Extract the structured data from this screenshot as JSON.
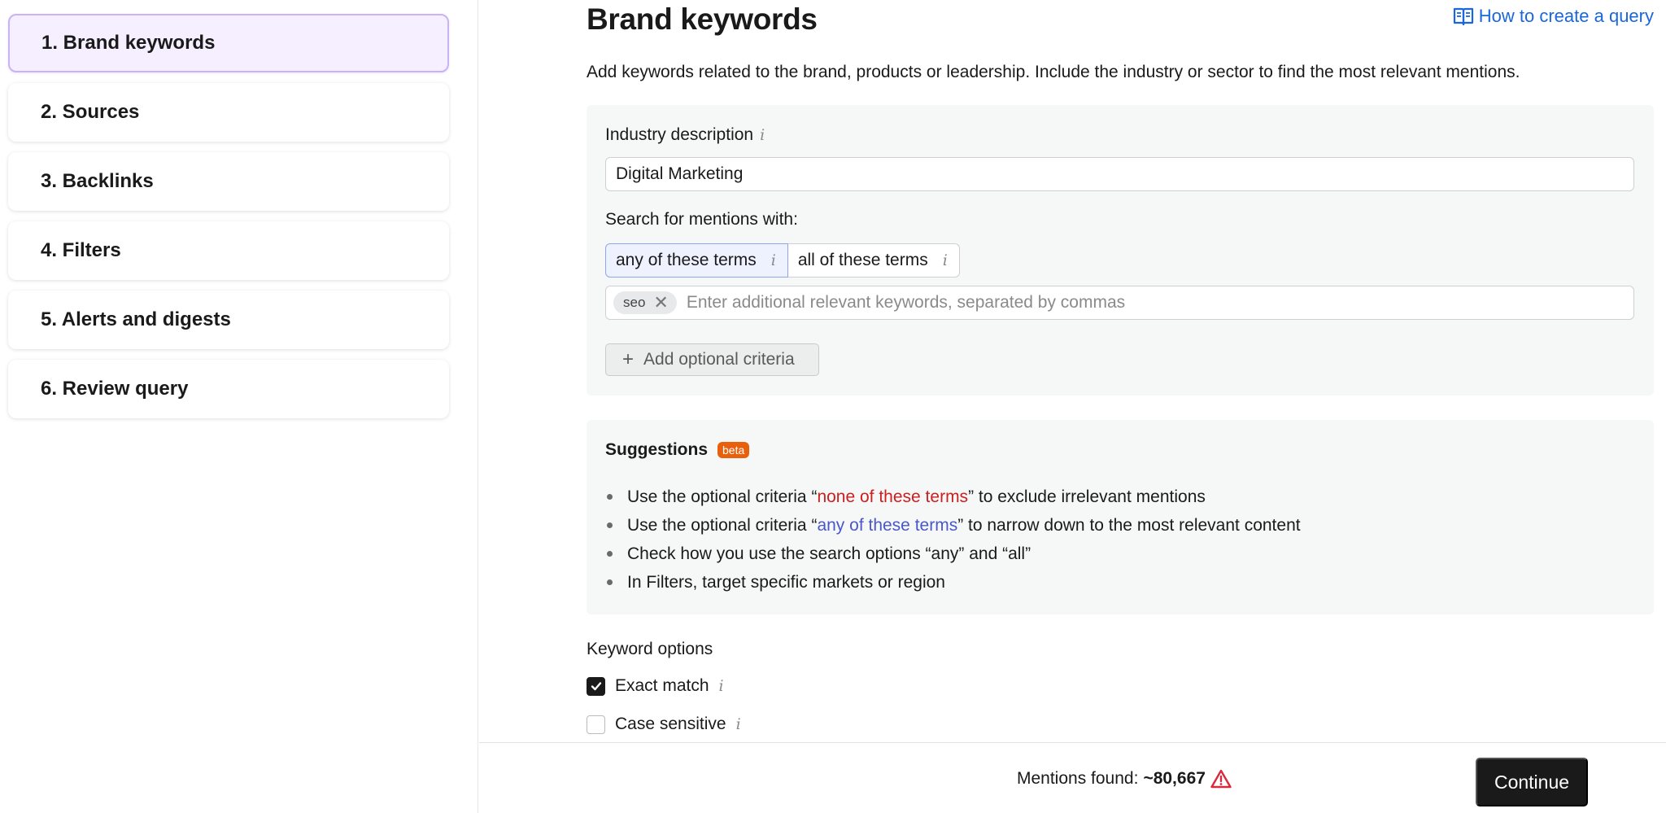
{
  "sidebar": {
    "steps": [
      {
        "label": "1. Brand keywords",
        "active": true
      },
      {
        "label": "2. Sources"
      },
      {
        "label": "3. Backlinks"
      },
      {
        "label": "4. Filters"
      },
      {
        "label": "5. Alerts and digests"
      },
      {
        "label": "6. Review query"
      }
    ]
  },
  "header": {
    "title": "Brand keywords",
    "howto_link": "How to create a query",
    "howto_icon": "open-book-icon",
    "description": "Add keywords related to the brand, products or leadership. Include the industry or sector to find the most relevant mentions."
  },
  "industry": {
    "label": "Industry description",
    "info_icon": "info-icon",
    "value": "Digital Marketing"
  },
  "search_mode": {
    "label": "Search for mentions with:",
    "options": [
      {
        "label": "any of these terms",
        "selected": true
      },
      {
        "label": "all of these terms",
        "selected": false
      }
    ]
  },
  "keywords": {
    "tags": [
      "seo"
    ],
    "placeholder": "Enter additional relevant keywords, separated by commas"
  },
  "add_criteria": {
    "icon": "plus-icon",
    "label": "Add optional criteria"
  },
  "suggestions": {
    "title": "Suggestions",
    "badge": "beta",
    "items": [
      {
        "pre": "Use the optional criteria “",
        "hl": "none of these terms",
        "post": "” to exclude irrelevant mentions",
        "hl_color": "#cc1f1f"
      },
      {
        "pre": "Use the optional criteria “",
        "hl": "any of these terms",
        "post": "” to narrow down to the most relevant content",
        "hl_color": "#4a57c9"
      },
      {
        "pre": "Check how you use the search options “any” and “all”",
        "hl": "",
        "post": ""
      },
      {
        "pre": "In Filters, target specific markets or region",
        "hl": "",
        "post": ""
      }
    ]
  },
  "keyword_options": {
    "title": "Keyword options",
    "exact_match": {
      "label": "Exact match",
      "checked": true
    },
    "case_sensitive": {
      "label": "Case sensitive",
      "checked": false
    }
  },
  "footer": {
    "mentions_label": "Mentions found:",
    "mentions_value": "~80,667",
    "warning_icon": "warning-triangle-icon",
    "continue_label": "Continue"
  },
  "colors": {
    "accent_blue": "#1a66dd",
    "active_step_bg": "#f5efff",
    "beta_badge": "#e8600c",
    "warning": "#d9293a"
  }
}
